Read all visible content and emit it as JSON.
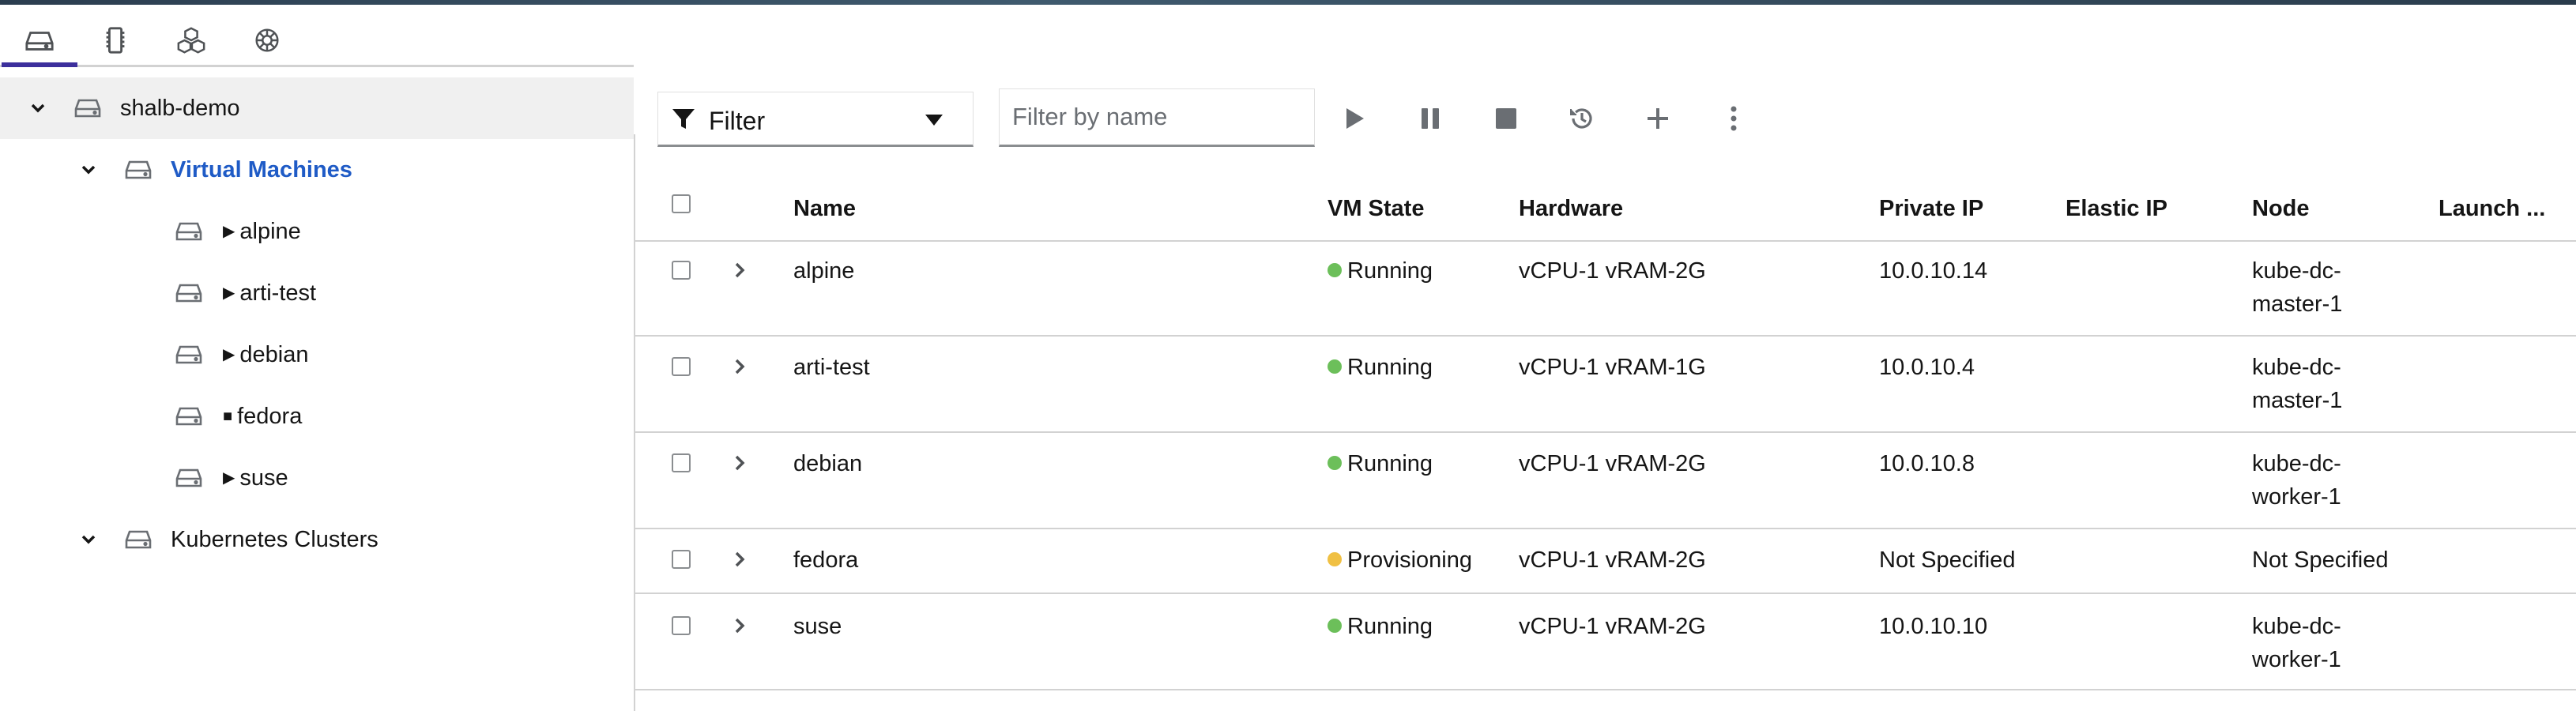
{
  "colors": {
    "running": "#6cbf5a",
    "provisioning": "#f0c043",
    "accent": "#1f5bc6",
    "active_tab": "#3c2f9c"
  },
  "icon_tabs": [
    {
      "icon": "storage-icon",
      "active": true
    },
    {
      "icon": "memory-chip-icon",
      "active": false
    },
    {
      "icon": "cubes-icon",
      "active": false
    },
    {
      "icon": "helm-icon",
      "active": false
    }
  ],
  "tree": {
    "root": {
      "label": "shalb-demo",
      "icon": "server-icon",
      "toggle": "chevron-down-icon"
    },
    "virtual_machines": {
      "label": "Virtual Machines",
      "icon": "server-icon",
      "toggle": "chevron-down-icon"
    },
    "vms": [
      {
        "state_glyph": "▶",
        "label": "alpine"
      },
      {
        "state_glyph": "▶",
        "label": "arti-test"
      },
      {
        "state_glyph": "▶",
        "label": "debian"
      },
      {
        "state_glyph": "■",
        "label": "fedora"
      },
      {
        "state_glyph": "▶",
        "label": "suse"
      }
    ],
    "kubernetes_clusters": {
      "label": "Kubernetes Clusters",
      "icon": "server-icon",
      "toggle": "chevron-down-icon"
    }
  },
  "toolbar": {
    "filter_label": "Filter",
    "filter_placeholder": "Filter by name",
    "actions": [
      "play-icon",
      "pause-icon",
      "stop-icon",
      "restart-icon",
      "plus-icon",
      "kebab-menu-icon"
    ]
  },
  "table": {
    "columns": [
      "Name",
      "VM State",
      "Hardware",
      "Private IP",
      "Elastic IP",
      "Node",
      "Launch ..."
    ],
    "rows": [
      {
        "name": "alpine",
        "state": "Running",
        "state_color": "#6cbf5a",
        "hardware": "vCPU-1 vRAM-2G",
        "private_ip": "10.0.10.14",
        "elastic_ip": "",
        "node": "kube-dc-master-1",
        "launch": ""
      },
      {
        "name": "arti-test",
        "state": "Running",
        "state_color": "#6cbf5a",
        "hardware": "vCPU-1 vRAM-1G",
        "private_ip": "10.0.10.4",
        "elastic_ip": "",
        "node": "kube-dc-master-1",
        "launch": ""
      },
      {
        "name": "debian",
        "state": "Running",
        "state_color": "#6cbf5a",
        "hardware": "vCPU-1 vRAM-2G",
        "private_ip": "10.0.10.8",
        "elastic_ip": "",
        "node": "kube-dc-worker-1",
        "launch": ""
      },
      {
        "name": "fedora",
        "state": "Provisioning",
        "state_color": "#f0c043",
        "hardware": "vCPU-1 vRAM-2G",
        "private_ip": "Not Specified",
        "elastic_ip": "",
        "node": "Not Specified",
        "launch": ""
      },
      {
        "name": "suse",
        "state": "Running",
        "state_color": "#6cbf5a",
        "hardware": "vCPU-1 vRAM-2G",
        "private_ip": "10.0.10.10",
        "elastic_ip": "",
        "node": "kube-dc-worker-1",
        "launch": ""
      }
    ]
  }
}
